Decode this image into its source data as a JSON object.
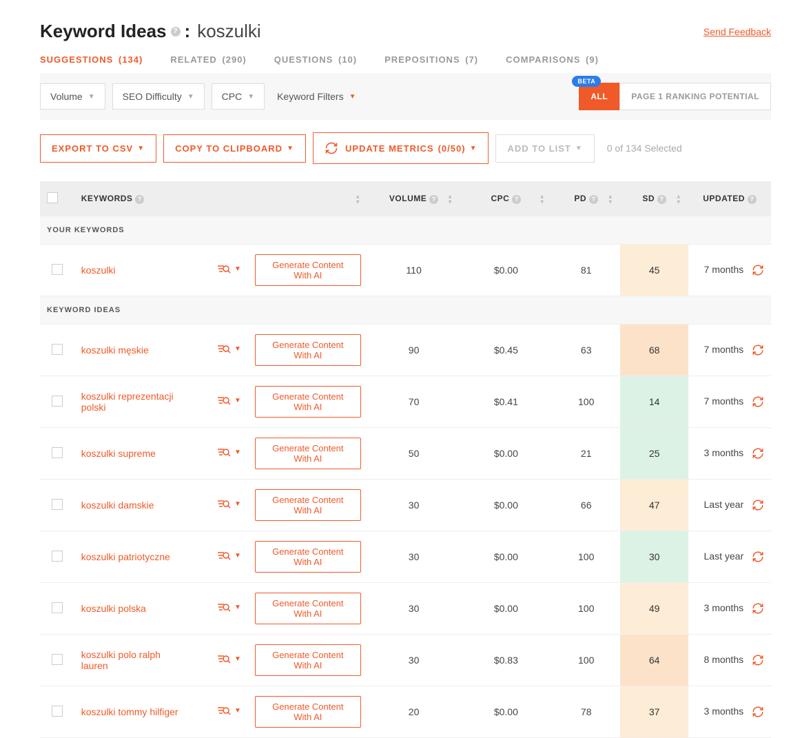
{
  "header": {
    "title": "Keyword Ideas",
    "keyword": "koszulki",
    "feedback": "Send Feedback"
  },
  "tabs": [
    {
      "label": "SUGGESTIONS",
      "count": "(134)",
      "active": true
    },
    {
      "label": "RELATED",
      "count": "(290)",
      "active": false
    },
    {
      "label": "QUESTIONS",
      "count": "(10)",
      "active": false
    },
    {
      "label": "PREPOSITIONS",
      "count": "(7)",
      "active": false
    },
    {
      "label": "COMPARISONS",
      "count": "(9)",
      "active": false
    }
  ],
  "filters": {
    "volume": "Volume",
    "seo_difficulty": "SEO Difficulty",
    "cpc": "CPC",
    "keyword_filters": "Keyword Filters",
    "beta": "BETA",
    "all": "ALL",
    "ranking": "PAGE 1 RANKING POTENTIAL"
  },
  "actions": {
    "export": "EXPORT TO CSV",
    "copy": "COPY TO CLIPBOARD",
    "update": "UPDATE METRICS",
    "update_count": "(0/50)",
    "add": "ADD TO LIST",
    "selected": "0 of 134 Selected"
  },
  "columns": {
    "keywords": "KEYWORDS",
    "volume": "VOLUME",
    "cpc": "CPC",
    "pd": "PD",
    "sd": "SD",
    "updated": "UPDATED"
  },
  "sections": {
    "your": "YOUR KEYWORDS",
    "ideas": "KEYWORD IDEAS"
  },
  "gen_label": "Generate Content With AI",
  "rows_your": [
    {
      "kw": "koszulki",
      "vol": "110",
      "cpc": "$0.00",
      "pd": "81",
      "sd": "45",
      "sd_bg": "#fdecd6",
      "upd": "7 months"
    }
  ],
  "rows_ideas": [
    {
      "kw": "koszulki męskie",
      "vol": "90",
      "cpc": "$0.45",
      "pd": "63",
      "sd": "68",
      "sd_bg": "#fde2ca",
      "upd": "7 months"
    },
    {
      "kw": "koszulki reprezentacji polski",
      "vol": "70",
      "cpc": "$0.41",
      "pd": "100",
      "sd": "14",
      "sd_bg": "#dcf2e5",
      "upd": "7 months"
    },
    {
      "kw": "koszulki supreme",
      "vol": "50",
      "cpc": "$0.00",
      "pd": "21",
      "sd": "25",
      "sd_bg": "#dcf2e5",
      "upd": "3 months"
    },
    {
      "kw": "koszulki damskie",
      "vol": "30",
      "cpc": "$0.00",
      "pd": "66",
      "sd": "47",
      "sd_bg": "#fdecd6",
      "upd": "Last year"
    },
    {
      "kw": "koszulki patriotyczne",
      "vol": "30",
      "cpc": "$0.00",
      "pd": "100",
      "sd": "30",
      "sd_bg": "#dcf2e5",
      "upd": "Last year"
    },
    {
      "kw": "koszulki polska",
      "vol": "30",
      "cpc": "$0.00",
      "pd": "100",
      "sd": "49",
      "sd_bg": "#fdecd6",
      "upd": "3 months"
    },
    {
      "kw": "koszulki polo ralph lauren",
      "vol": "30",
      "cpc": "$0.83",
      "pd": "100",
      "sd": "64",
      "sd_bg": "#fde2ca",
      "upd": "8 months"
    },
    {
      "kw": "koszulki tommy hilfiger",
      "vol": "20",
      "cpc": "$0.00",
      "pd": "78",
      "sd": "37",
      "sd_bg": "#fdecd6",
      "upd": "3 months"
    }
  ]
}
